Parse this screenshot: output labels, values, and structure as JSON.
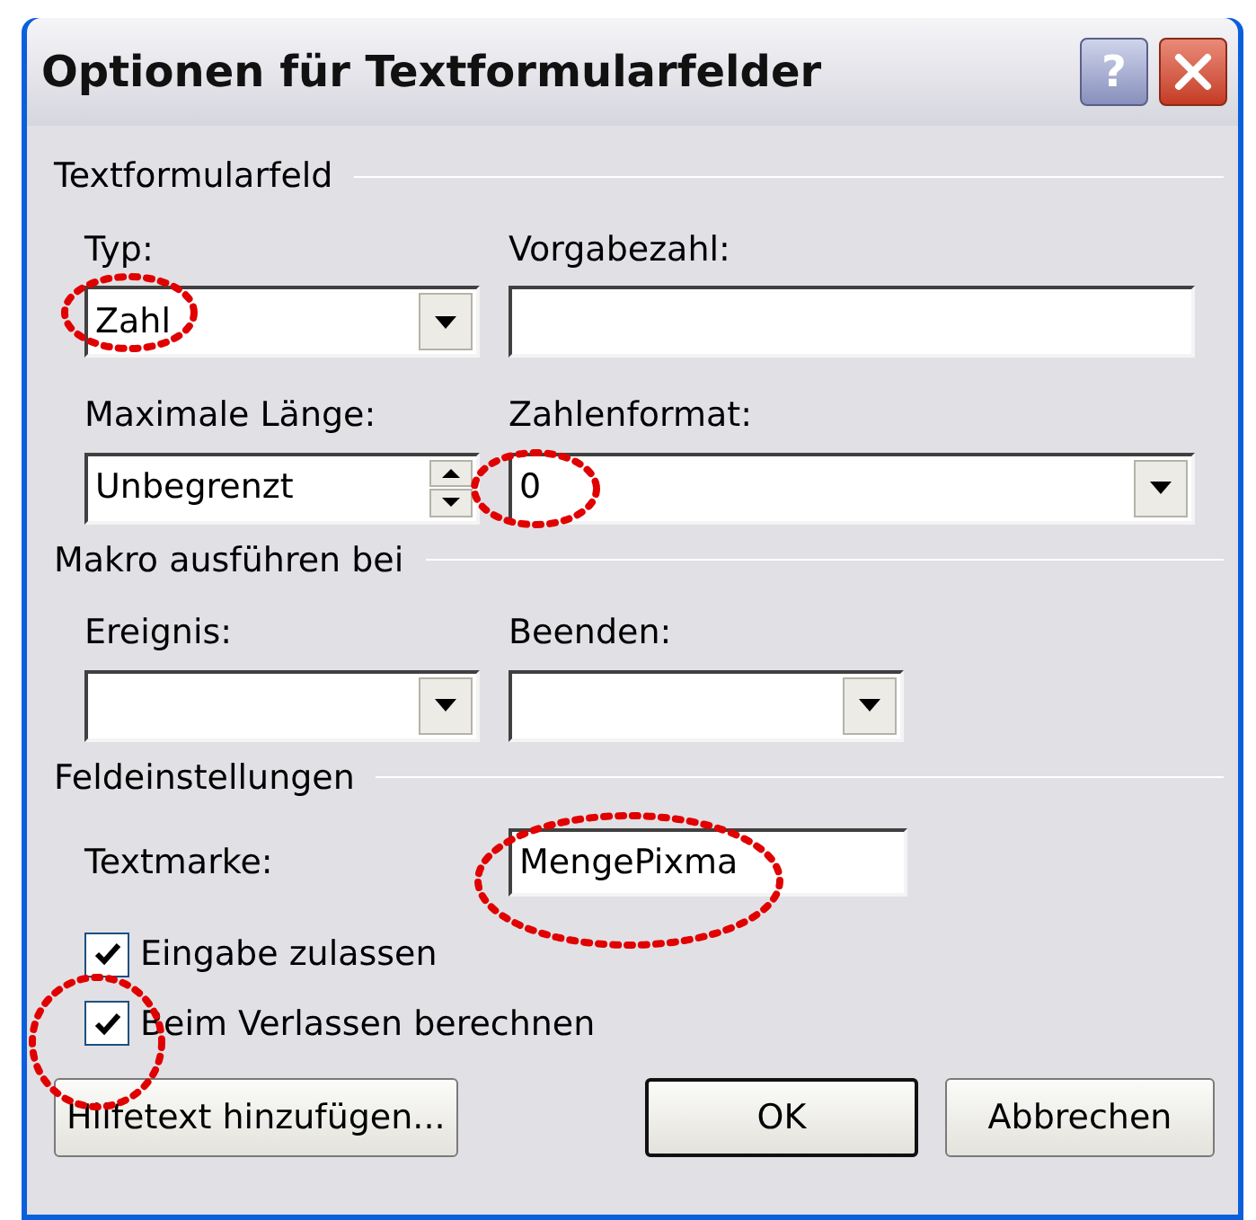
{
  "window": {
    "title": "Optionen für Textformularfelder",
    "help_button": "?"
  },
  "sections": [
    {
      "title": "Textformularfeld",
      "rows": [
        [
          {
            "kind": "combo",
            "label": "Typ:",
            "value": "Zahl"
          },
          {
            "kind": "text",
            "label": "Vorgabezahl:"
          }
        ],
        [
          {
            "kind": "spin",
            "label": "Maximale Länge:",
            "value": "Unbegrenzt"
          },
          {
            "kind": "combo",
            "label": "Zahlenformat:",
            "value": "0"
          }
        ]
      ]
    },
    {
      "title": "Makro ausführen bei",
      "rows": [
        [
          {
            "kind": "combo",
            "label": "Ereignis:"
          },
          {
            "kind": "combo",
            "label": "Beenden:"
          }
        ]
      ]
    },
    {
      "title": "Feldeinstellungen",
      "bookmark": {
        "label": "Textmarke:",
        "value": "MengePixma"
      },
      "checkboxes": [
        {
          "label": "Eingabe zulassen",
          "checked": true
        },
        {
          "label": "Beim Verlassen berechnen",
          "checked": true
        }
      ]
    }
  ],
  "buttons": [
    {
      "label": "Hilfetext hinzufügen...",
      "default": false
    },
    {
      "label": "OK",
      "default": true
    },
    {
      "label": "Abbrechen",
      "default": false
    }
  ]
}
